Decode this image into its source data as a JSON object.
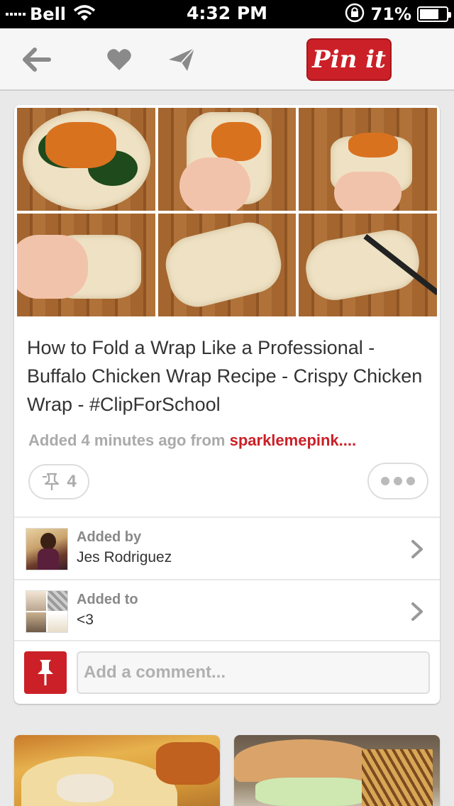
{
  "status_bar": {
    "carrier": "Bell",
    "time": "4:32 PM",
    "battery": "71%",
    "battery_level": 0.71
  },
  "nav": {
    "back_icon": "arrow-left-icon",
    "like_icon": "heart-icon",
    "send_icon": "paper-plane-icon",
    "pin_it_label": "Pin it"
  },
  "pin": {
    "title": "How to Fold a Wrap Like a Professional - Buffalo Chicken Wrap Recipe - Crispy Chicken Wrap - #ClipForSchool",
    "attribution_prefix": "Added 4 minutes ago from ",
    "source": "sparklemepink....",
    "repin_count": "4"
  },
  "added_by": {
    "label": "Added by",
    "name": "Jes Rodriguez"
  },
  "added_to": {
    "label": "Added to",
    "board": "<3"
  },
  "comment": {
    "placeholder": "Add a comment..."
  },
  "colors": {
    "brand_red": "#cb2027",
    "background": "#e9e9e9"
  }
}
